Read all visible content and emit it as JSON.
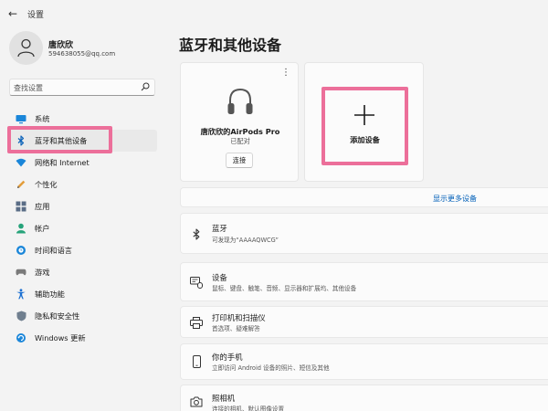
{
  "window": {
    "title": "设置",
    "back_icon": "back-arrow-icon"
  },
  "user": {
    "name": "唐欣欣",
    "email": "594638055@qq.com"
  },
  "search": {
    "placeholder": "查找设置"
  },
  "sidebar": {
    "items": [
      {
        "label": "系统",
        "icon": "monitor-icon",
        "active": false
      },
      {
        "label": "蓝牙和其他设备",
        "icon": "bluetooth-icon",
        "active": true
      },
      {
        "label": "网络和 Internet",
        "icon": "wifi-icon",
        "active": false
      },
      {
        "label": "个性化",
        "icon": "pen-icon",
        "active": false
      },
      {
        "label": "应用",
        "icon": "apps-icon",
        "active": false
      },
      {
        "label": "帐户",
        "icon": "account-icon",
        "active": false
      },
      {
        "label": "时间和语言",
        "icon": "globe-clock-icon",
        "active": false
      },
      {
        "label": "游戏",
        "icon": "gamepad-icon",
        "active": false
      },
      {
        "label": "辅助功能",
        "icon": "accessibility-icon",
        "active": false
      },
      {
        "label": "隐私和安全性",
        "icon": "shield-icon",
        "active": false
      },
      {
        "label": "Windows 更新",
        "icon": "windows-update-icon",
        "active": false
      }
    ]
  },
  "main": {
    "title": "蓝牙和其他设备",
    "device_card": {
      "name": "唐欣欣的AirPods Pro",
      "status": "已配对",
      "action": "连接",
      "more": "⋮",
      "icon": "headphones-icon"
    },
    "add_card": {
      "label": "添加设备",
      "icon": "plus-icon"
    },
    "show_more": "显示更多设备",
    "rows": {
      "bluetooth": {
        "title": "蓝牙",
        "subtitle": "可发现为“AAAAQWCG”",
        "icon": "bluetooth-icon"
      },
      "devices": {
        "title": "设备",
        "subtitle": "鼠标、键盘、触笔、音频、显示器和扩展坞、其他设备",
        "icon": "keyboard-mouse-icon"
      },
      "printers": {
        "title": "打印机和扫描仪",
        "subtitle": "首选项、疑难解答",
        "icon": "printer-icon"
      },
      "phone": {
        "title": "你的手机",
        "subtitle": "立即访问 Android 设备的照片、短信及其他",
        "icon": "phone-icon"
      },
      "camera": {
        "title": "照相机",
        "subtitle": "连接的相机、默认图像设置",
        "icon": "camera-icon"
      }
    }
  },
  "colors": {
    "accent": "#0067c0",
    "link": "#005fb8",
    "highlight": "#ec6f9a",
    "background": "#f3f3f3",
    "card": "#fbfbfb"
  }
}
